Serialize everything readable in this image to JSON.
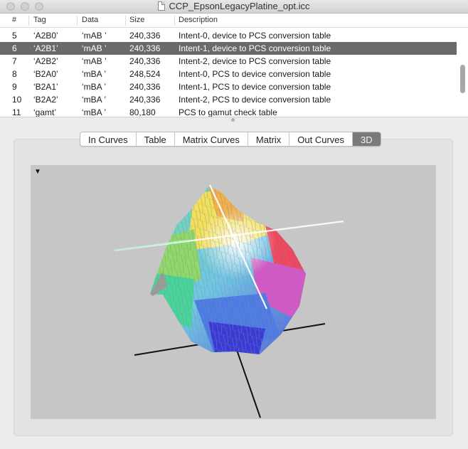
{
  "window": {
    "title": "CCP_EpsonLegacyPlatine_opt.icc"
  },
  "table": {
    "columns": [
      "#",
      "Tag",
      "Data",
      "Size",
      "Description"
    ],
    "rows": [
      {
        "num": "5",
        "tag": "‘A2B0’",
        "data": "‘mAB ’",
        "size": "240,336",
        "desc": "Intent-0, device to PCS conversion table",
        "selected": false
      },
      {
        "num": "6",
        "tag": "‘A2B1’",
        "data": "‘mAB ’",
        "size": "240,336",
        "desc": "Intent-1, device to PCS conversion table",
        "selected": true
      },
      {
        "num": "7",
        "tag": "‘A2B2’",
        "data": "‘mAB ’",
        "size": "240,336",
        "desc": "Intent-2, device to PCS conversion table",
        "selected": false
      },
      {
        "num": "8",
        "tag": "‘B2A0’",
        "data": "‘mBA ’",
        "size": "248,524",
        "desc": "Intent-0, PCS to device conversion table",
        "selected": false
      },
      {
        "num": "9",
        "tag": "‘B2A1’",
        "data": "‘mBA ’",
        "size": "240,336",
        "desc": "Intent-1, PCS to device conversion table",
        "selected": false
      },
      {
        "num": "10",
        "tag": "‘B2A2’",
        "data": "‘mBA ’",
        "size": "240,336",
        "desc": "Intent-2, PCS to device conversion table",
        "selected": false
      },
      {
        "num": "11",
        "tag": "‘gamt’",
        "data": "‘mBA ’",
        "size": "80,180",
        "desc": "PCS to gamut check table",
        "selected": false
      }
    ]
  },
  "tabs": [
    {
      "label": "In Curves",
      "active": false
    },
    {
      "label": "Table",
      "active": false
    },
    {
      "label": "Matrix Curves",
      "active": false
    },
    {
      "label": "Matrix",
      "active": false
    },
    {
      "label": "Out Curves",
      "active": false
    },
    {
      "label": "3D",
      "active": true
    }
  ],
  "viewer": {
    "disclosure_icon": "triangle-down-icon",
    "background": "#c6c6c6"
  },
  "colors": {
    "selection": "#6a6a6a",
    "active_tab": "#7a7a7a"
  }
}
